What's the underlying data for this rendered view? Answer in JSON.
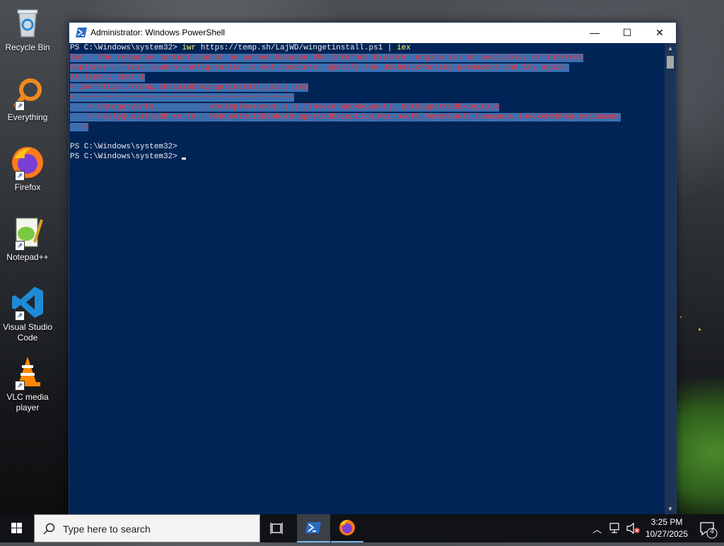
{
  "desktop": {
    "icons": [
      {
        "label": "Recycle Bin"
      },
      {
        "label": "Everything"
      },
      {
        "label": "Firefox"
      },
      {
        "label": "Notepad++"
      },
      {
        "label": "Visual Studio Code"
      },
      {
        "label": "VLC media player"
      }
    ]
  },
  "window": {
    "title": "Administrator: Windows PowerShell",
    "minimize_glyph": "—",
    "maximize_glyph": "☐",
    "close_glyph": "✕",
    "console": {
      "prompt1": "PS C:\\Windows\\system32> ",
      "command_name": "iwr",
      "command_args": " https://temp.sh/LajWD/wingetinstall.ps1 | ",
      "command_pipe": "iex",
      "err1": "iwr : The response content cannot be parsed because the Internet Explorer engine is not available, or Internet",
      "err2": "Explorer's first-launch configuration is not complete. Specify the UseBasicParsing parameter and try again.",
      "err3": "At line:1 char:1",
      "err4": "+ iwr https://temp.sh/LajWD/wingetinstall.ps1 | iex",
      "err5": "+ ~~~~~~~~~~~~~~~~~~~~~~~~~~~~~~~~~~~~~~~~~~~~~~",
      "err6": "    + CategoryInfo          : NotImplemented: (:) [Invoke-WebRequest], NotSupportedException",
      "err7": "    + FullyQualifiedErrorId : WebCmdletIEDomNotSupportedException,Microsoft.PowerShell.Commands.InvokeWebRequestComman",
      "err8": "   d",
      "prompt2": "PS C:\\Windows\\system32>",
      "prompt3": "PS C:\\Windows\\system32> "
    }
  },
  "taskbar": {
    "search_placeholder": "Type here to search",
    "time": "3:25 PM",
    "date": "10/27/2025",
    "notification_count": "4"
  },
  "colors": {
    "console_bg": "#012456",
    "error_red": "#ff2b2b",
    "command_yellow": "#ffff66",
    "selection": "#3b6fb0"
  }
}
